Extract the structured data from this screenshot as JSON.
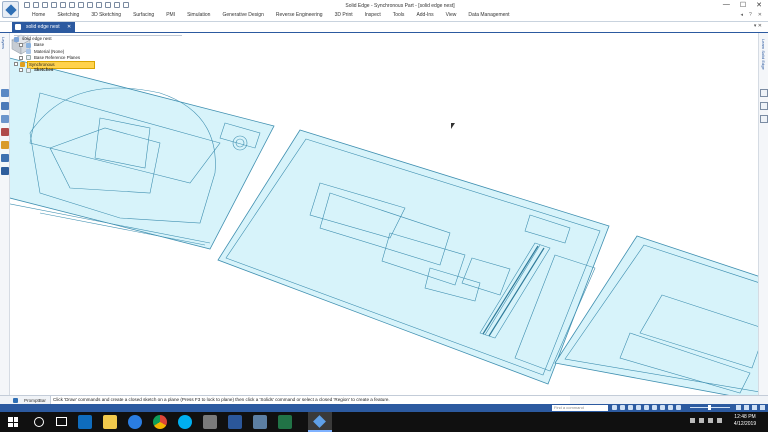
{
  "window": {
    "title": "Solid Edge - Synchronous Part - [solid edge nest]",
    "controls": {
      "minimize": "—",
      "maximize": "☐",
      "close": "✕"
    }
  },
  "ribbon": {
    "tabs": [
      "Home",
      "Sketching",
      "3D Sketching",
      "Surfacing",
      "PMI",
      "Simulation",
      "Generative Design",
      "Reverse Engineering",
      "3D Print",
      "Inspect",
      "Tools",
      "Add-Ins",
      "View",
      "Data Management"
    ],
    "right_glyphs": [
      "◂",
      "?",
      "✕"
    ]
  },
  "document": {
    "tab_label": "solid edge nest",
    "tab_close": "✕",
    "right_glyphs": "▾ ✕"
  },
  "left_panel": {
    "label": "Layers"
  },
  "right_panel": {
    "label": "Learn Solid Edge"
  },
  "tree": {
    "items": [
      {
        "label": "solid edge nest",
        "selected": false
      },
      {
        "label": "Base",
        "selected": false
      },
      {
        "label": "Material (None)",
        "selected": false
      },
      {
        "label": "Base Reference Planes",
        "selected": false
      },
      {
        "label": "Synchronous",
        "selected": true
      },
      {
        "label": "Sketches",
        "selected": false
      }
    ]
  },
  "promptbar": {
    "label": "PromptBar",
    "text": "Click 'Draw' commands and create a closed sketch on a plane (Press F3 to lock to plane) then click a 'Solids' command or select a closed 'Region' to create a feature."
  },
  "statusbar": {
    "search_placeholder": "Find a command"
  },
  "taskbar": {
    "time": "12:48 PM",
    "date": "4/12/2019"
  },
  "colors": {
    "accent": "#2c5aa0",
    "sketch_fill": "#d7f3fa",
    "sketch_stroke": "#3f8fb0",
    "selected": "#ffd24d"
  },
  "icons": [
    "app-logo-icon",
    "undo-icon",
    "redo-icon",
    "save-icon",
    "windows-start-icon",
    "search-icon",
    "task-view-icon",
    "outlook-icon",
    "file-explorer-icon",
    "edge-icon",
    "chrome-icon",
    "skype-icon",
    "word-icon",
    "excel-icon",
    "solid-edge-icon"
  ]
}
